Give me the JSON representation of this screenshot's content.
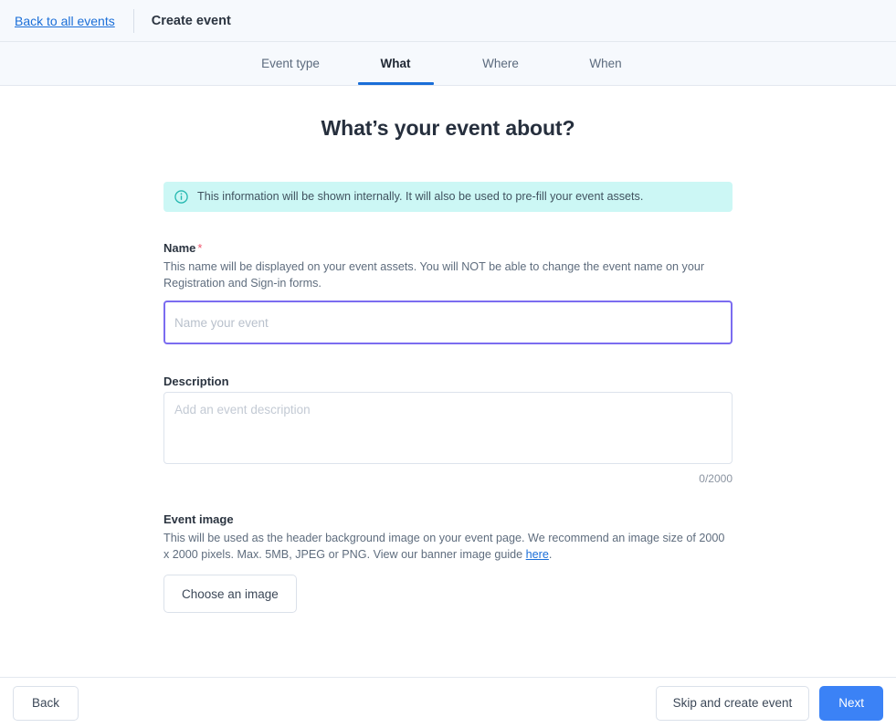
{
  "header": {
    "back_link": "Back to all events",
    "title": "Create event"
  },
  "tabs": [
    {
      "label": "Event type",
      "active": false
    },
    {
      "label": "What",
      "active": true
    },
    {
      "label": "Where",
      "active": false
    },
    {
      "label": "When",
      "active": false
    }
  ],
  "main": {
    "heading": "What’s your event about?",
    "banner": {
      "icon": "info-circle-icon",
      "text": "This information will be shown internally. It will also be used to pre-fill your event assets."
    },
    "name_field": {
      "label": "Name",
      "required_marker": "*",
      "help": "This name will be displayed on your event assets. You will NOT be able to change the event name on your Registration and Sign-in forms.",
      "value": "",
      "placeholder": "Name your event"
    },
    "description_field": {
      "label": "Description",
      "value": "",
      "placeholder": "Add an event description",
      "counter": "0/2000"
    },
    "event_image": {
      "label": "Event image",
      "help_before_link": "This will be used as the header background image on your event page. We recommend an image size of 2000 x 2000 pixels. Max. 5MB, JPEG or PNG. View our banner image guide ",
      "link_text": "here",
      "help_after_link": ".",
      "button_label": "Choose an image"
    }
  },
  "footer": {
    "back_label": "Back",
    "skip_label": "Skip and create event",
    "next_label": "Next"
  },
  "colors": {
    "accent_blue": "#3b82f6",
    "link_blue": "#1a6ed8",
    "focus_purple": "#7b6cf0",
    "banner_bg": "#ccf7f5",
    "banner_icon": "#25b8b0",
    "required_red": "#f0566d",
    "bar_bg": "#f6f9fd"
  }
}
